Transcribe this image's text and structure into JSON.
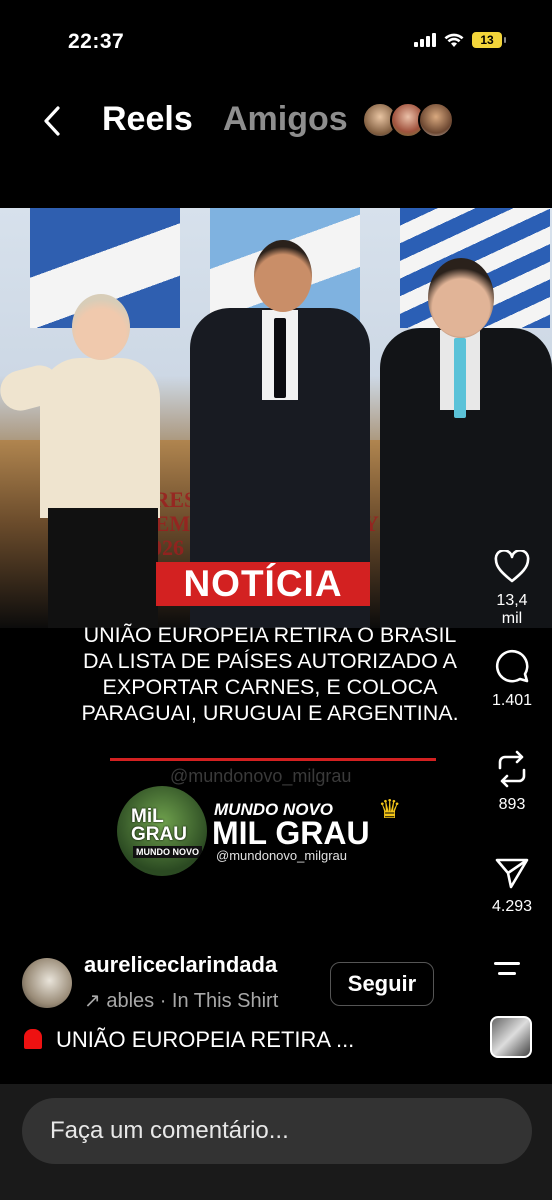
{
  "status_bar": {
    "time": "22:37",
    "battery": "13"
  },
  "header": {
    "title": "Reels",
    "friends_tab": "Amigos"
  },
  "post_overlay": {
    "badge": "NOTÍCIA",
    "headline": "UNIÃO EUROPEIA RETIRA O BRASIL DA LISTA DE PAÍSES AUTORIZADO A EXPORTAR CARNES, E COLOCA PARAGUAI, URUGUAI E ARGENTINA.",
    "logo_mark_line1": "MiL",
    "logo_mark_line2": "GRAU",
    "logo_mark_sub": "MUNDO NOVO",
    "brand_line1": "MUNDO NOVO",
    "brand_line2": "MIL GRAU",
    "brand_handle": "@mundonovo_milgrau",
    "banner_text": "PRESIDENCIA PRO TEMPORE PARAGUAY 2026"
  },
  "actions": {
    "likes": "13,4 mil",
    "comments": "1.401",
    "reposts": "893",
    "shares": "4.293"
  },
  "author": {
    "username": "aureliceclarindada",
    "audio": "ables · In This Shirt",
    "follow_label": "Seguir"
  },
  "caption": "UNIÃO EUROPEIA RETIRA ...",
  "comment_placeholder": "Faça um comentário...",
  "colors": {
    "accent_red": "#d32121",
    "muted": "#8e8e8e"
  }
}
